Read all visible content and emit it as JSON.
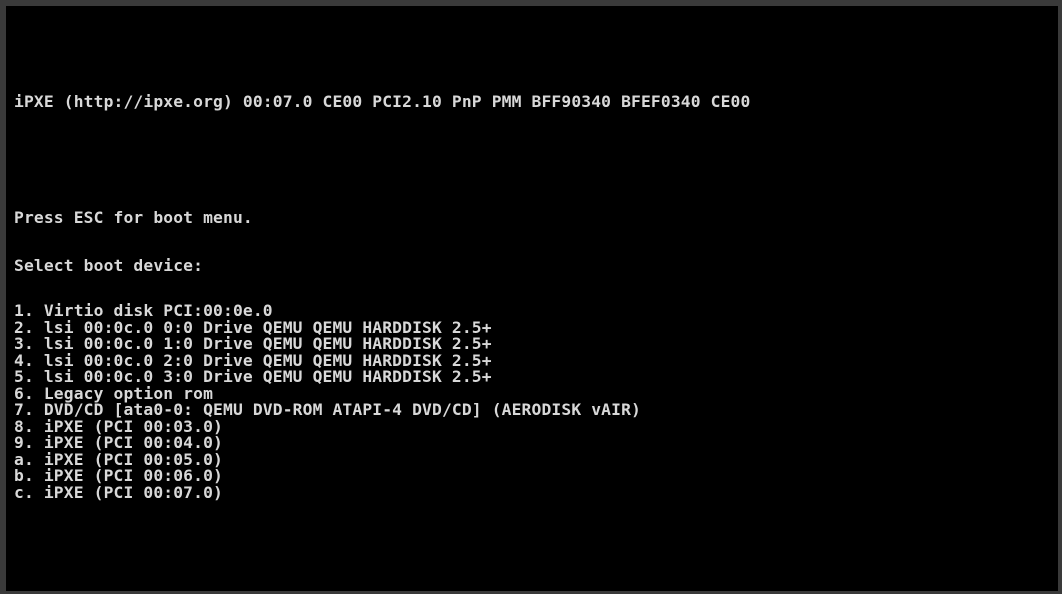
{
  "console": {
    "banner": "iPXE (http://ipxe.org) 00:07.0 CE00 PCI2.10 PnP PMM BFF90340 BFEF0340 CE00",
    "esc_prompt": "Press ESC for boot menu.",
    "select_prompt": "Select boot device:",
    "boot_devices": [
      "1. Virtio disk PCI:00:0e.0",
      "2. lsi 00:0c.0 0:0 Drive QEMU QEMU HARDDISK 2.5+",
      "3. lsi 00:0c.0 1:0 Drive QEMU QEMU HARDDISK 2.5+",
      "4. lsi 00:0c.0 2:0 Drive QEMU QEMU HARDDISK 2.5+",
      "5. lsi 00:0c.0 3:0 Drive QEMU QEMU HARDDISK 2.5+",
      "6. Legacy option rom",
      "7. DVD/CD [ata0-0: QEMU DVD-ROM ATAPI-4 DVD/CD] (AERODISK vAIR)",
      "8. iPXE (PCI 00:03.0)",
      "9. iPXE (PCI 00:04.0)",
      "a. iPXE (PCI 00:05.0)",
      "b. iPXE (PCI 00:06.0)",
      "c. iPXE (PCI 00:07.0)"
    ],
    "colors": {
      "background": "#000000",
      "text": "#d8d8d8",
      "frame": "#3a3a3a"
    }
  }
}
